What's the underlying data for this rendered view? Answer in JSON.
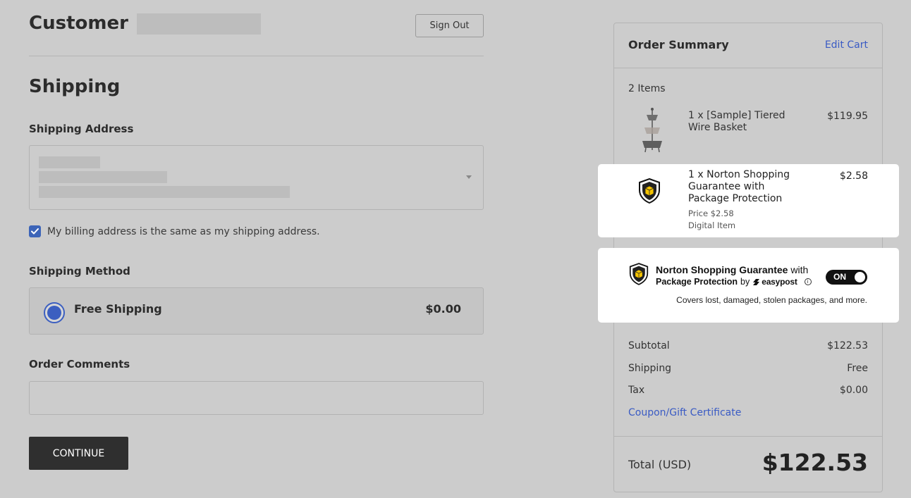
{
  "customer": {
    "title": "Customer",
    "sign_out_label": "Sign Out"
  },
  "shipping": {
    "title": "Shipping",
    "address_label": "Shipping Address",
    "billing_same_label": "My billing address is the same as my shipping address.",
    "billing_same_checked": true,
    "method_label": "Shipping Method",
    "method": {
      "name": "Free Shipping",
      "price": "$0.00",
      "selected": true
    },
    "comments_label": "Order Comments",
    "comments_value": "",
    "continue_label": "CONTINUE"
  },
  "summary": {
    "title": "Order Summary",
    "edit_cart_label": "Edit Cart",
    "items_count": "2 Items",
    "items": [
      {
        "name": "1 x [Sample] Tiered Wire Basket",
        "price": "$119.95"
      },
      {
        "name": "1 x Norton Shopping Guarantee with Package Protection",
        "price": "$2.58",
        "price_note": "Price $2.58",
        "type_note": "Digital Item"
      }
    ],
    "lines": [
      {
        "label": "Subtotal",
        "value": "$122.53"
      },
      {
        "label": "Shipping",
        "value": "Free"
      },
      {
        "label": "Tax",
        "value": "$0.00"
      }
    ],
    "coupon_label": "Coupon/Gift Certificate",
    "total_label": "Total (USD)",
    "total_value": "$122.53"
  },
  "ngp_widget": {
    "title_bold": "Norton Shopping Guarantee",
    "title_rest": "with",
    "subtitle_bold": "Package Protection",
    "subtitle_by": "by",
    "brand": "easypost",
    "toggle_label": "ON",
    "toggle_on": true,
    "description": "Covers lost, damaged, stolen packages, and more."
  },
  "icons": [
    "checkmark-icon",
    "chevron-down-icon",
    "shield-package-icon",
    "info-icon",
    "easypost-logo-icon"
  ],
  "colors": {
    "accent_blue": "#3c5fc0",
    "link_blue": "#3a5bc4",
    "button_dark": "#2f2f2f",
    "toggle_bg": "#111111"
  }
}
